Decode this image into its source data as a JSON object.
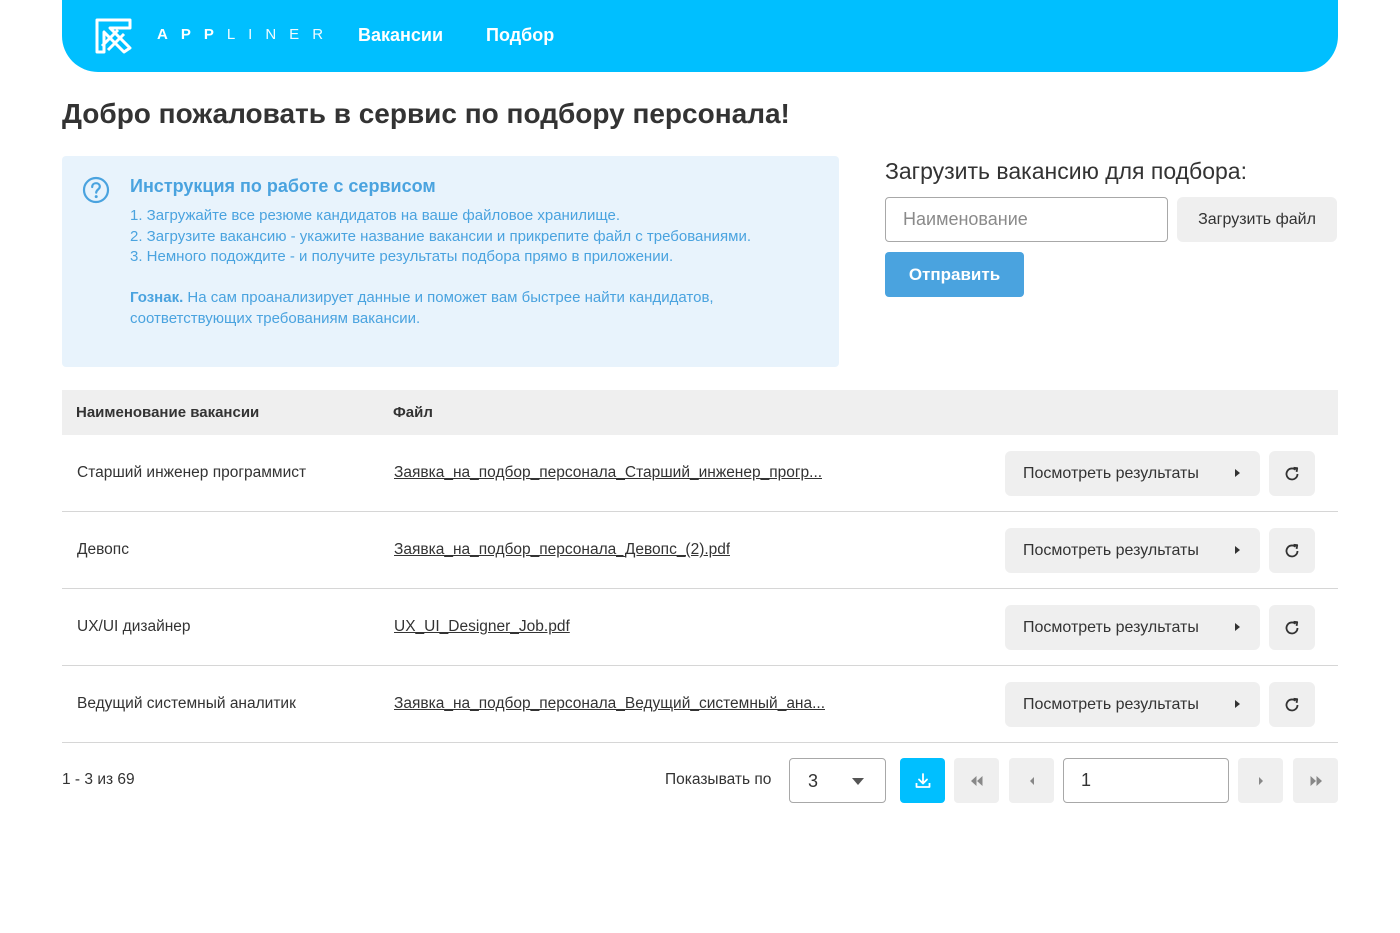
{
  "header": {
    "logo_bold": "APP",
    "logo_light": "LINER",
    "nav": [
      {
        "label": "Вакансии"
      },
      {
        "label": "Подбор"
      }
    ],
    "accent_color": "#00bfff"
  },
  "page_title": "Добро пожаловать в сервис по подбору персонала!",
  "info": {
    "icon": "question-circle-icon",
    "title": "Инструкция по работе с сервисом",
    "steps": [
      "1. Загружайте все резюме кандидатов на ваше файловое хранилище.",
      "2. Загрузите вакансию - укажите название вакансии и прикрепите файл с требованиями.",
      "3. Немного подождите - и получите результаты подбора прямо в приложении."
    ],
    "note_bold": "Гознак.",
    "note_text": " На сам проанализирует данные и поможет вам быстрее найти кандидатов, соответствующих требованиям вакансии."
  },
  "upload": {
    "title": "Загрузить вакансию для подбора:",
    "name_placeholder": "Наименование",
    "file_button": "Загрузить файл",
    "submit_button": "Отправить"
  },
  "table": {
    "columns": [
      "Наименование вакансии",
      "Файл"
    ],
    "view_label": "Посмотреть результаты",
    "rows": [
      {
        "name": "Старший инженер программист",
        "file": "Заявка_на_подбор_персонала_Старший_инженер_прогр..."
      },
      {
        "name": "Девопс",
        "file": "Заявка_на_подбор_персонала_Девопс_(2).pdf"
      },
      {
        "name": "UX/UI дизайнер",
        "file": "UX_UI_Designer_Job.pdf"
      },
      {
        "name": "Ведущий системный аналитик",
        "file": "Заявка_на_подбор_персонала_Ведущий_системный_ана..."
      }
    ]
  },
  "pagination": {
    "range": "1 - 3 из 69",
    "per_page_label": "Показывать по",
    "per_page_value": "3",
    "current_page": "1"
  }
}
